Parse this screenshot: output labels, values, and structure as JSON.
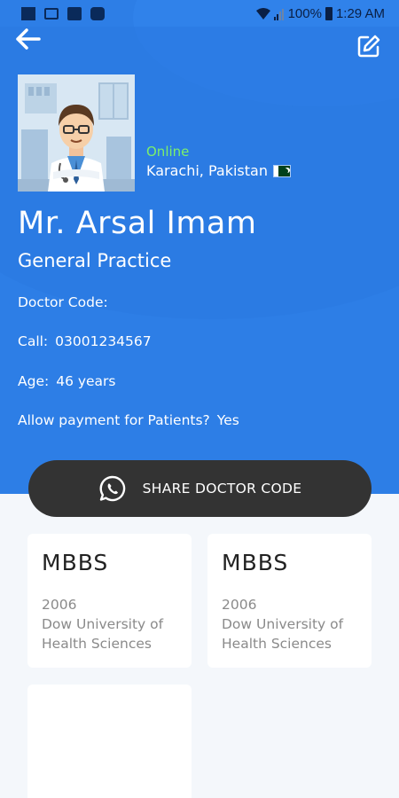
{
  "status_bar": {
    "battery": "100%",
    "time": "1:29 AM"
  },
  "doctor": {
    "status": "Online",
    "location": "Karachi, Pakistan",
    "name": "Mr. Arsal Imam",
    "specialty": "General Practice"
  },
  "details": [
    {
      "label": "Doctor Code:",
      "value": ""
    },
    {
      "label": "Call:",
      "value": "03001234567"
    },
    {
      "label": "Age:",
      "value": "46 years"
    },
    {
      "label": "Allow payment for Patients?",
      "value": "Yes"
    }
  ],
  "share_button": {
    "label": "SHARE DOCTOR CODE"
  },
  "qualifications": [
    {
      "degree": "MBBS",
      "year": "2006",
      "institute_line1": "Dow University of",
      "institute_line2": "Health Sciences"
    },
    {
      "degree": "MBBS",
      "year": "2006",
      "institute_line1": "Dow University of",
      "institute_line2": "Health Sciences"
    }
  ],
  "colors": {
    "header_blue": "#2d7ee6",
    "online_green": "#7cf06b",
    "button_dark": "#333333",
    "background": "#f4f7fb"
  },
  "icons": [
    "back-arrow-icon",
    "edit-icon",
    "whatsapp-icon",
    "wifi-icon",
    "signal-icon",
    "battery-icon"
  ]
}
